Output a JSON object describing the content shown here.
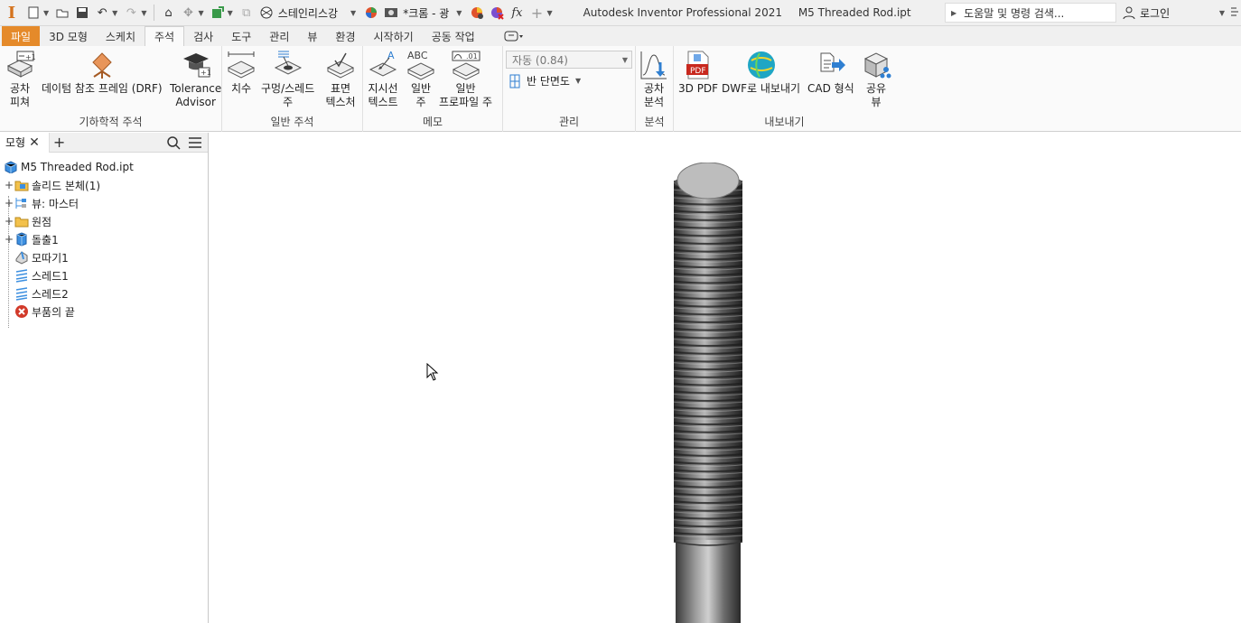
{
  "app": {
    "title": "Autodesk Inventor Professional 2021",
    "document": "M5 Threaded Rod.ipt",
    "material": "스테인리스강",
    "appearance": "*크롬 - 광",
    "search_placeholder": "도움말 및 명령 검색...",
    "login": "로그인",
    "fx_label": "fx"
  },
  "tabs": [
    {
      "label": "파일"
    },
    {
      "label": "3D 모형"
    },
    {
      "label": "스케치"
    },
    {
      "label": "주석"
    },
    {
      "label": "검사"
    },
    {
      "label": "도구"
    },
    {
      "label": "관리"
    },
    {
      "label": "뷰"
    },
    {
      "label": "환경"
    },
    {
      "label": "시작하기"
    },
    {
      "label": "공동 작업"
    }
  ],
  "ribbon": {
    "geometric": {
      "title": "기하학적 주석",
      "tools": [
        {
          "label": "공차\n피쳐"
        },
        {
          "label": "데이텀 참조 프레임 (DRF)"
        },
        {
          "label": "Tolerance\nAdvisor"
        }
      ]
    },
    "general": {
      "title": "일반 주석",
      "tools": [
        {
          "label": "치수"
        },
        {
          "label": "구멍/스레드\n주"
        },
        {
          "label": "표면\n텍스처"
        }
      ]
    },
    "notes": {
      "title": "메모",
      "tools": [
        {
          "label": "지시선\n텍스트"
        },
        {
          "label": "일반\n주"
        },
        {
          "label": "일반\n프로파일 주"
        }
      ]
    },
    "manage": {
      "title": "관리",
      "scale_value": "자동 (0.84)",
      "half_section": "반 단면도"
    },
    "analysis": {
      "title": "분석",
      "tools": [
        {
          "label": "공차\n분석"
        }
      ]
    },
    "export": {
      "title": "내보내기",
      "tools": [
        {
          "label": "3D PDF"
        },
        {
          "label": "DWF로 내보내기"
        },
        {
          "label": "CAD 형식"
        },
        {
          "label": "공유\n뷰"
        }
      ]
    },
    "icon_text": {
      "abc": "ABC",
      "a": "A",
      "zero_one": ".01",
      "pdf": "PDF",
      "plus_one": "+1"
    }
  },
  "browser": {
    "tab": "모형",
    "tree": [
      {
        "label": "M5 Threaded Rod.ipt",
        "icon": "part-icon"
      },
      {
        "label": "솔리드 본체(1)",
        "icon": "folder-solid-icon"
      },
      {
        "label": "뷰: 마스터",
        "icon": "view-icon"
      },
      {
        "label": "원점",
        "icon": "folder-icon"
      },
      {
        "label": "돌출1",
        "icon": "extrude-icon"
      },
      {
        "label": "모따기1",
        "icon": "chamfer-icon"
      },
      {
        "label": "스레드1",
        "icon": "thread-icon"
      },
      {
        "label": "스레드2",
        "icon": "thread-icon"
      },
      {
        "label": "부품의 끝",
        "icon": "end-of-part-icon"
      }
    ]
  },
  "colors": {
    "file_tab": "#e58a2a",
    "end_of_part": "#d23a2a",
    "folder": "#f3c14b",
    "accent_blue": "#2f7fd1"
  }
}
